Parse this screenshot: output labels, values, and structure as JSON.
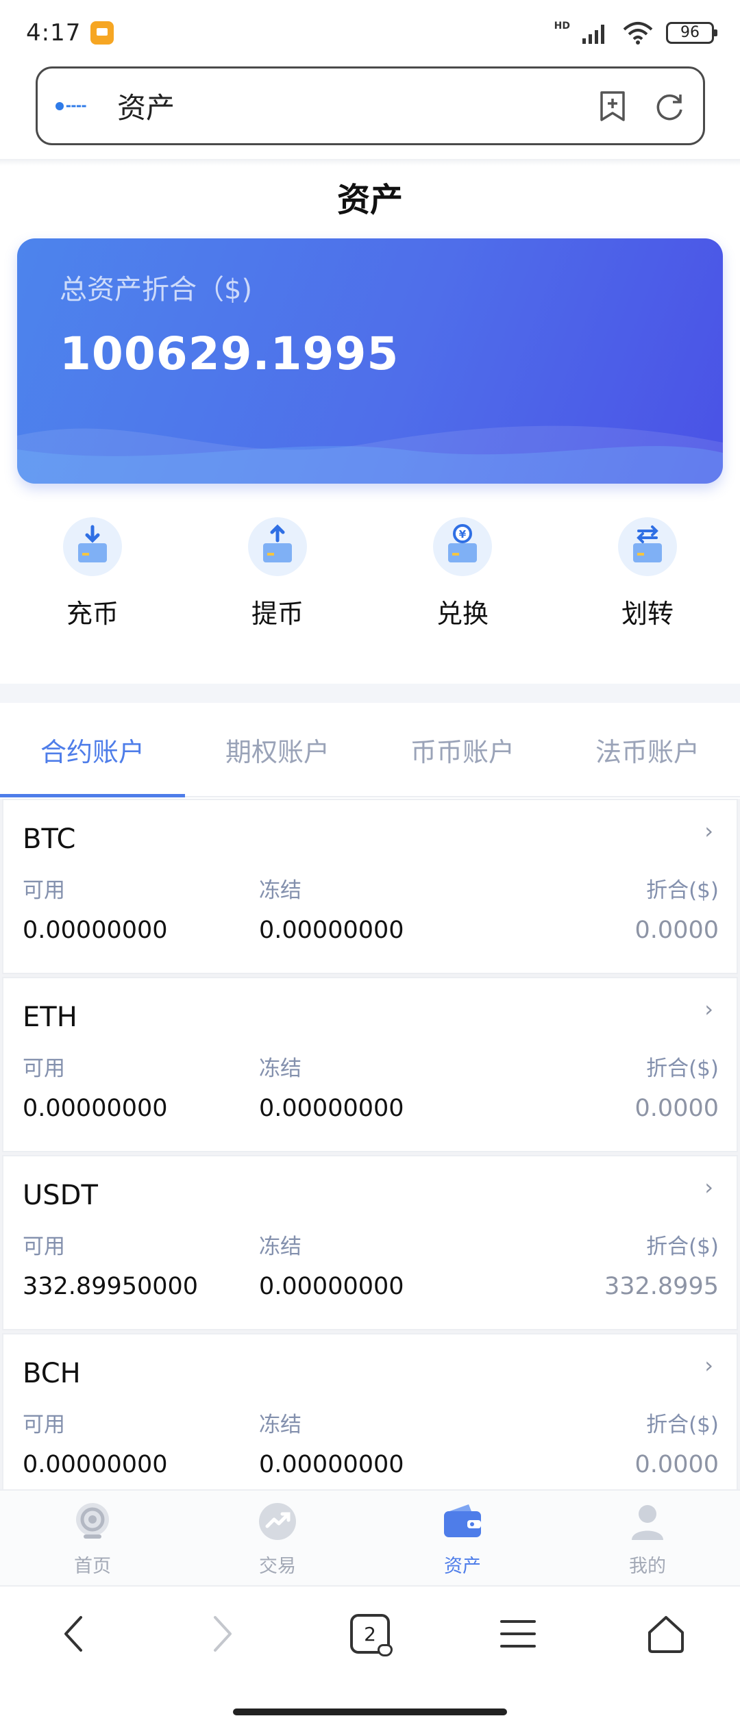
{
  "status_bar": {
    "time": "4:17",
    "network": "HD",
    "battery": "96"
  },
  "browser": {
    "page_title": "资产",
    "tab_count": "2"
  },
  "page": {
    "title": "资产"
  },
  "asset_card": {
    "label": "总资产折合（$)",
    "value": "100629.1995"
  },
  "actions": [
    {
      "label": "充币",
      "icon": "deposit-icon"
    },
    {
      "label": "提币",
      "icon": "withdraw-icon"
    },
    {
      "label": "兑换",
      "icon": "exchange-icon"
    },
    {
      "label": "划转",
      "icon": "transfer-icon"
    }
  ],
  "tabs": [
    {
      "label": "合约账户",
      "active": true
    },
    {
      "label": "期权账户"
    },
    {
      "label": "币币账户"
    },
    {
      "label": "法币账户"
    }
  ],
  "column_labels": {
    "available": "可用",
    "frozen": "冻结",
    "converted": "折合($)"
  },
  "accounts": [
    {
      "name": "BTC",
      "available": "0.00000000",
      "frozen": "0.00000000",
      "converted": "0.0000"
    },
    {
      "name": "ETH",
      "available": "0.00000000",
      "frozen": "0.00000000",
      "converted": "0.0000"
    },
    {
      "name": "USDT",
      "available": "332.89950000",
      "frozen": "0.00000000",
      "converted": "332.8995"
    },
    {
      "name": "BCH",
      "available": "0.00000000",
      "frozen": "0.00000000",
      "converted": "0.0000"
    }
  ],
  "bottom_nav": [
    {
      "label": "首页",
      "icon": "home-icon"
    },
    {
      "label": "交易",
      "icon": "trade-icon"
    },
    {
      "label": "资产",
      "icon": "wallet-icon",
      "active": true
    },
    {
      "label": "我的",
      "icon": "profile-icon"
    }
  ],
  "colors": {
    "accent": "#4e7de9",
    "card_start": "#4d84ec",
    "card_end": "#4a52e6",
    "muted": "#9aa3b8"
  }
}
